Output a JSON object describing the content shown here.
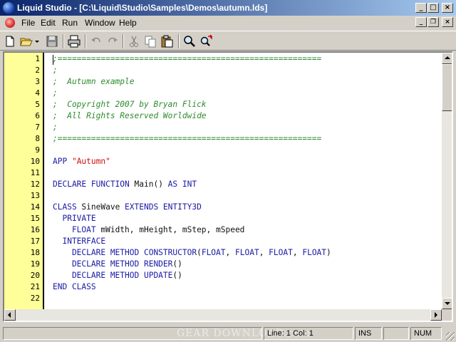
{
  "window": {
    "title": "Liquid Studio - [C:\\Liquid\\Studio\\Samples\\Demos\\autumn.lds]",
    "controls": {
      "minimize": "_",
      "maximize": "□",
      "close": "×",
      "doc_restore": "❐"
    }
  },
  "menu": {
    "items": [
      "File",
      "Edit",
      "Run",
      "Window",
      "Help"
    ]
  },
  "toolbar": {
    "buttons": [
      "new-file-icon",
      "open-folder-icon",
      "dropdown-arrow-icon",
      "save-icon",
      "print-icon",
      "undo-icon",
      "redo-icon",
      "cut-icon",
      "copy-icon",
      "paste-icon",
      "find-icon",
      "find-replace-icon"
    ]
  },
  "editor": {
    "line_numbers": [
      "1",
      "2",
      "3",
      "4",
      "5",
      "6",
      "7",
      "8",
      "9",
      "10",
      "11",
      "12",
      "13",
      "14",
      "15",
      "16",
      "17",
      "18",
      "19",
      "20",
      "21",
      "22"
    ],
    "lines": [
      [
        {
          "t": "c",
          "v": ";======================================================="
        }
      ],
      [
        {
          "t": "c",
          "v": ";"
        }
      ],
      [
        {
          "t": "c",
          "v": ";  Autumn example"
        }
      ],
      [
        {
          "t": "c",
          "v": ";"
        }
      ],
      [
        {
          "t": "c",
          "v": ";  Copyright 2007 by Bryan Flick"
        }
      ],
      [
        {
          "t": "c",
          "v": ";  All Rights Reserved Worldwide"
        }
      ],
      [
        {
          "t": "c",
          "v": ";"
        }
      ],
      [
        {
          "t": "c",
          "v": ";======================================================="
        }
      ],
      [],
      [
        {
          "t": "k",
          "v": "APP "
        },
        {
          "t": "s",
          "v": "\"Autumn\""
        }
      ],
      [],
      [
        {
          "t": "k",
          "v": "DECLARE FUNCTION "
        },
        {
          "t": "i",
          "v": "Main() "
        },
        {
          "t": "k",
          "v": "AS INT"
        }
      ],
      [],
      [
        {
          "t": "k",
          "v": "CLASS "
        },
        {
          "t": "i",
          "v": "SineWave "
        },
        {
          "t": "k",
          "v": "EXTENDS ENTITY3D"
        }
      ],
      [
        {
          "t": "k",
          "v": "  PRIVATE"
        }
      ],
      [
        {
          "t": "k",
          "v": "    FLOAT "
        },
        {
          "t": "i",
          "v": "mWidth, mHeight, mStep, mSpeed"
        }
      ],
      [
        {
          "t": "k",
          "v": "  INTERFACE"
        }
      ],
      [
        {
          "t": "k",
          "v": "    DECLARE METHOD CONSTRUCTOR"
        },
        {
          "t": "i",
          "v": "("
        },
        {
          "t": "k",
          "v": "FLOAT"
        },
        {
          "t": "i",
          "v": ", "
        },
        {
          "t": "k",
          "v": "FLOAT"
        },
        {
          "t": "i",
          "v": ", "
        },
        {
          "t": "k",
          "v": "FLOAT"
        },
        {
          "t": "i",
          "v": ", "
        },
        {
          "t": "k",
          "v": "FLOAT"
        },
        {
          "t": "i",
          "v": ")"
        }
      ],
      [
        {
          "t": "k",
          "v": "    DECLARE METHOD RENDER"
        },
        {
          "t": "i",
          "v": "()"
        }
      ],
      [
        {
          "t": "k",
          "v": "    DECLARE METHOD UPDATE"
        },
        {
          "t": "i",
          "v": "()"
        }
      ],
      [
        {
          "t": "k",
          "v": "END CLASS"
        }
      ],
      []
    ]
  },
  "statusbar": {
    "panel1": "",
    "watermark": "GEAR DOWNLOAD.com",
    "position": "Line: 1 Col: 1",
    "mode": "INS",
    "panel4": "",
    "numlock": "NUM"
  }
}
